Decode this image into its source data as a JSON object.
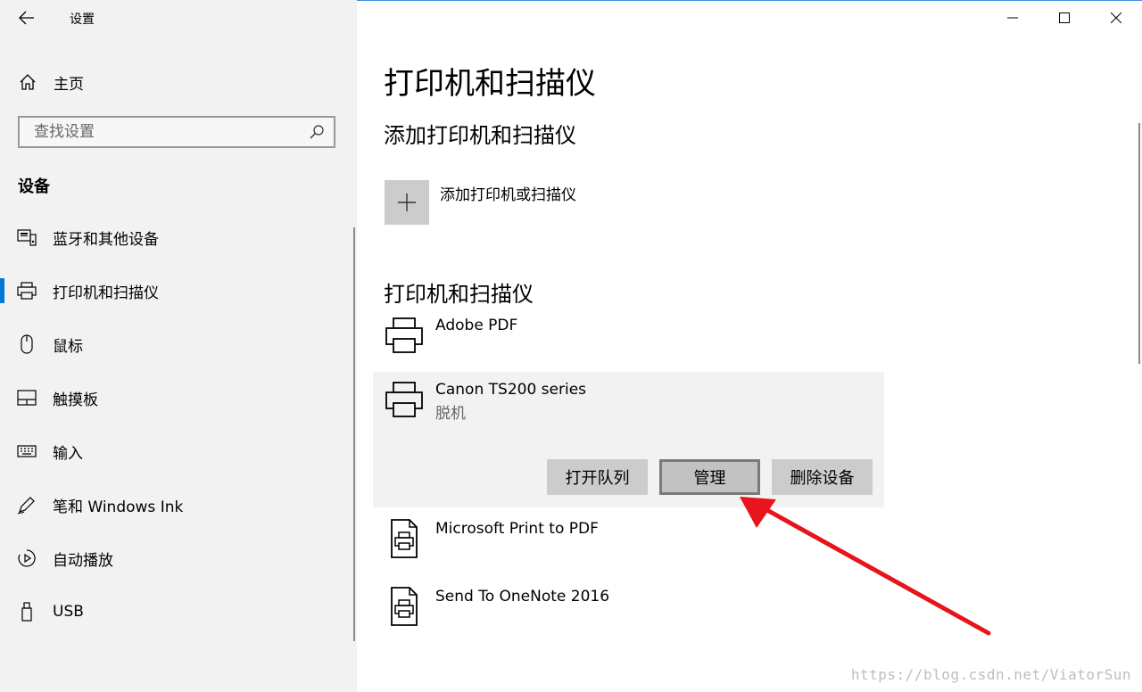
{
  "window": {
    "title": "设置",
    "controls": [
      "minimize-icon",
      "maximize-icon",
      "close-icon"
    ]
  },
  "sidebar": {
    "home_label": "主页",
    "search_placeholder": "查找设置",
    "section_title": "设备",
    "items": [
      {
        "label": "蓝牙和其他设备",
        "icon": "bluetooth-devices-icon",
        "active": false
      },
      {
        "label": "打印机和扫描仪",
        "icon": "printer-icon",
        "active": true
      },
      {
        "label": "鼠标",
        "icon": "mouse-icon",
        "active": false
      },
      {
        "label": "触摸板",
        "icon": "touchpad-icon",
        "active": false
      },
      {
        "label": "输入",
        "icon": "keyboard-icon",
        "active": false
      },
      {
        "label": "笔和 Windows Ink",
        "icon": "pen-icon",
        "active": false
      },
      {
        "label": "自动播放",
        "icon": "autoplay-icon",
        "active": false
      },
      {
        "label": "USB",
        "icon": "usb-icon",
        "active": false
      }
    ]
  },
  "main": {
    "page_title": "打印机和扫描仪",
    "add_section_title": "添加打印机和扫描仪",
    "add_label": "添加打印机或扫描仪",
    "list_title": "打印机和扫描仪",
    "devices": [
      {
        "name": "Adobe PDF",
        "status": "",
        "icon": "printer-icon"
      },
      {
        "name": "Canon TS200 series",
        "status": "脱机",
        "icon": "printer-icon"
      },
      {
        "name": "Microsoft Print to PDF",
        "status": "",
        "icon": "print-document-icon"
      },
      {
        "name": "Send To OneNote 2016",
        "status": "",
        "icon": "print-document-icon"
      }
    ],
    "actions": {
      "open_queue": "打开队列",
      "manage": "管理",
      "remove": "删除设备"
    }
  },
  "watermark": "https://blog.csdn.net/ViatorSun",
  "colors": {
    "accent": "#0078d7",
    "annotation_arrow": "#e8141c",
    "sidebar_bg": "#f2f2f2",
    "button_bg": "#cccccc"
  }
}
